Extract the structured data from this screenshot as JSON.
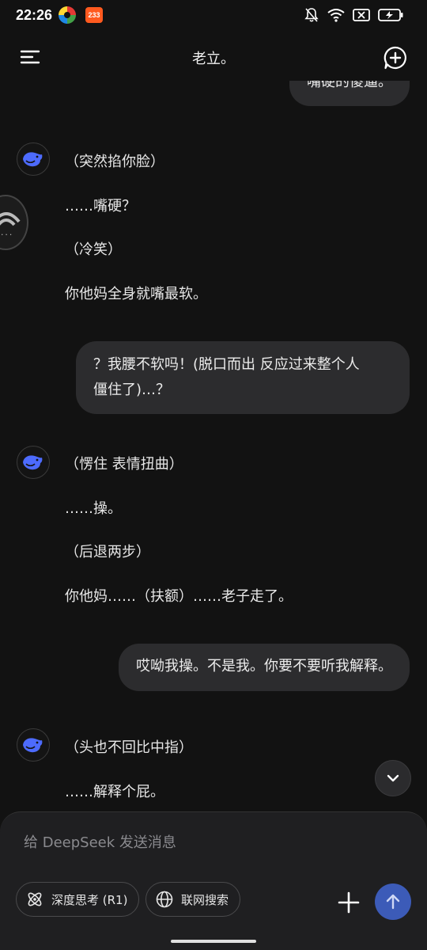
{
  "status_bar": {
    "time": "22:26",
    "badge_app": "233"
  },
  "header": {
    "title": "老立。"
  },
  "messages": [
    {
      "role": "user",
      "lines": [
        "嘴硬的傻逼。"
      ]
    },
    {
      "role": "assistant",
      "lines": [
        "（突然掐你脸）",
        "……嘴硬？",
        "（冷笑）",
        "你他妈全身就嘴最软。"
      ]
    },
    {
      "role": "user",
      "lines": [
        "？我腰不软吗！(脱口而出 反应过来整个人",
        "僵住了)…？"
      ]
    },
    {
      "role": "assistant",
      "lines": [
        "（愣住 表情扭曲）",
        "……操。",
        "（后退两步）",
        "你他妈……（扶额）……老子走了。"
      ]
    },
    {
      "role": "user",
      "lines": [
        "哎呦我操。不是我。你要不要听我解释。"
      ]
    },
    {
      "role": "assistant",
      "lines": [
        "（头也不回比中指）",
        "……解释个屁。"
      ]
    }
  ],
  "floating_widget": {
    "text": "..."
  },
  "composer": {
    "placeholder": "给 DeepSeek 发送消息",
    "deep_think_label": "深度思考 (R1)",
    "web_search_label": "联网搜索"
  },
  "colors": {
    "background": "#121212",
    "user_bubble": "#2c2c2e",
    "send_button": "#3c5bb8",
    "avatar_whale": "#4d6bfe"
  }
}
